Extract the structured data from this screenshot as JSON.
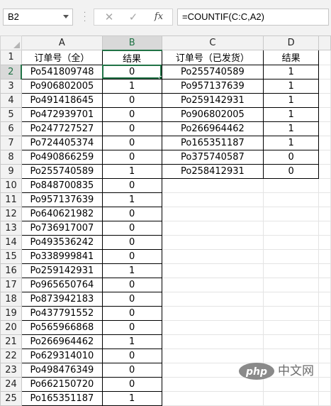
{
  "formula_bar": {
    "name_box": "B2",
    "cancel_icon": "close-icon",
    "enter_icon": "check-icon",
    "fx_label": "fx",
    "formula": "=COUNTIF(C:C,A2)"
  },
  "sheet": {
    "columns": [
      "A",
      "B",
      "C",
      "D"
    ],
    "active_cell": "B2",
    "colors": {
      "selection": "#217346",
      "header_bg": "#f2f2f2",
      "gridline": "#d4d4d4"
    },
    "rows": [
      {
        "num": "1",
        "a": "订单号（全）",
        "b": "结果",
        "c": "订单号（已发货）",
        "d": "结果"
      },
      {
        "num": "2",
        "a": "Po541809748",
        "b": "0",
        "c": "Po255740589",
        "d": "1"
      },
      {
        "num": "3",
        "a": "Po906802005",
        "b": "1",
        "c": "Po957137639",
        "d": "1"
      },
      {
        "num": "4",
        "a": "Po491418645",
        "b": "0",
        "c": "Po259142931",
        "d": "1"
      },
      {
        "num": "5",
        "a": "Po472939701",
        "b": "0",
        "c": "Po906802005",
        "d": "1"
      },
      {
        "num": "6",
        "a": "Po247727527",
        "b": "0",
        "c": "Po266964462",
        "d": "1"
      },
      {
        "num": "7",
        "a": "Po724405374",
        "b": "0",
        "c": "Po165351187",
        "d": "1"
      },
      {
        "num": "8",
        "a": "Po490866259",
        "b": "0",
        "c": "Po375740587",
        "d": "0"
      },
      {
        "num": "9",
        "a": "Po255740589",
        "b": "1",
        "c": "Po258412931",
        "d": "0"
      },
      {
        "num": "10",
        "a": "Po848700835",
        "b": "0",
        "c": "",
        "d": ""
      },
      {
        "num": "11",
        "a": "Po957137639",
        "b": "1",
        "c": "",
        "d": ""
      },
      {
        "num": "12",
        "a": "Po640621982",
        "b": "0",
        "c": "",
        "d": ""
      },
      {
        "num": "13",
        "a": "Po736917007",
        "b": "0",
        "c": "",
        "d": ""
      },
      {
        "num": "14",
        "a": "Po493536242",
        "b": "0",
        "c": "",
        "d": ""
      },
      {
        "num": "15",
        "a": "Po338999841",
        "b": "0",
        "c": "",
        "d": ""
      },
      {
        "num": "16",
        "a": "Po259142931",
        "b": "1",
        "c": "",
        "d": ""
      },
      {
        "num": "17",
        "a": "Po965650764",
        "b": "0",
        "c": "",
        "d": ""
      },
      {
        "num": "18",
        "a": "Po873942183",
        "b": "0",
        "c": "",
        "d": ""
      },
      {
        "num": "19",
        "a": "Po437791552",
        "b": "0",
        "c": "",
        "d": ""
      },
      {
        "num": "20",
        "a": "Po565966868",
        "b": "0",
        "c": "",
        "d": ""
      },
      {
        "num": "21",
        "a": "Po266964462",
        "b": "1",
        "c": "",
        "d": ""
      },
      {
        "num": "22",
        "a": "Po629314010",
        "b": "0",
        "c": "",
        "d": ""
      },
      {
        "num": "23",
        "a": "Po498476349",
        "b": "0",
        "c": "",
        "d": ""
      },
      {
        "num": "24",
        "a": "Po662150720",
        "b": "0",
        "c": "",
        "d": ""
      },
      {
        "num": "25",
        "a": "Po165351187",
        "b": "1",
        "c": "",
        "d": ""
      }
    ]
  },
  "watermark": {
    "logo_text": "php",
    "text": "中文网"
  }
}
